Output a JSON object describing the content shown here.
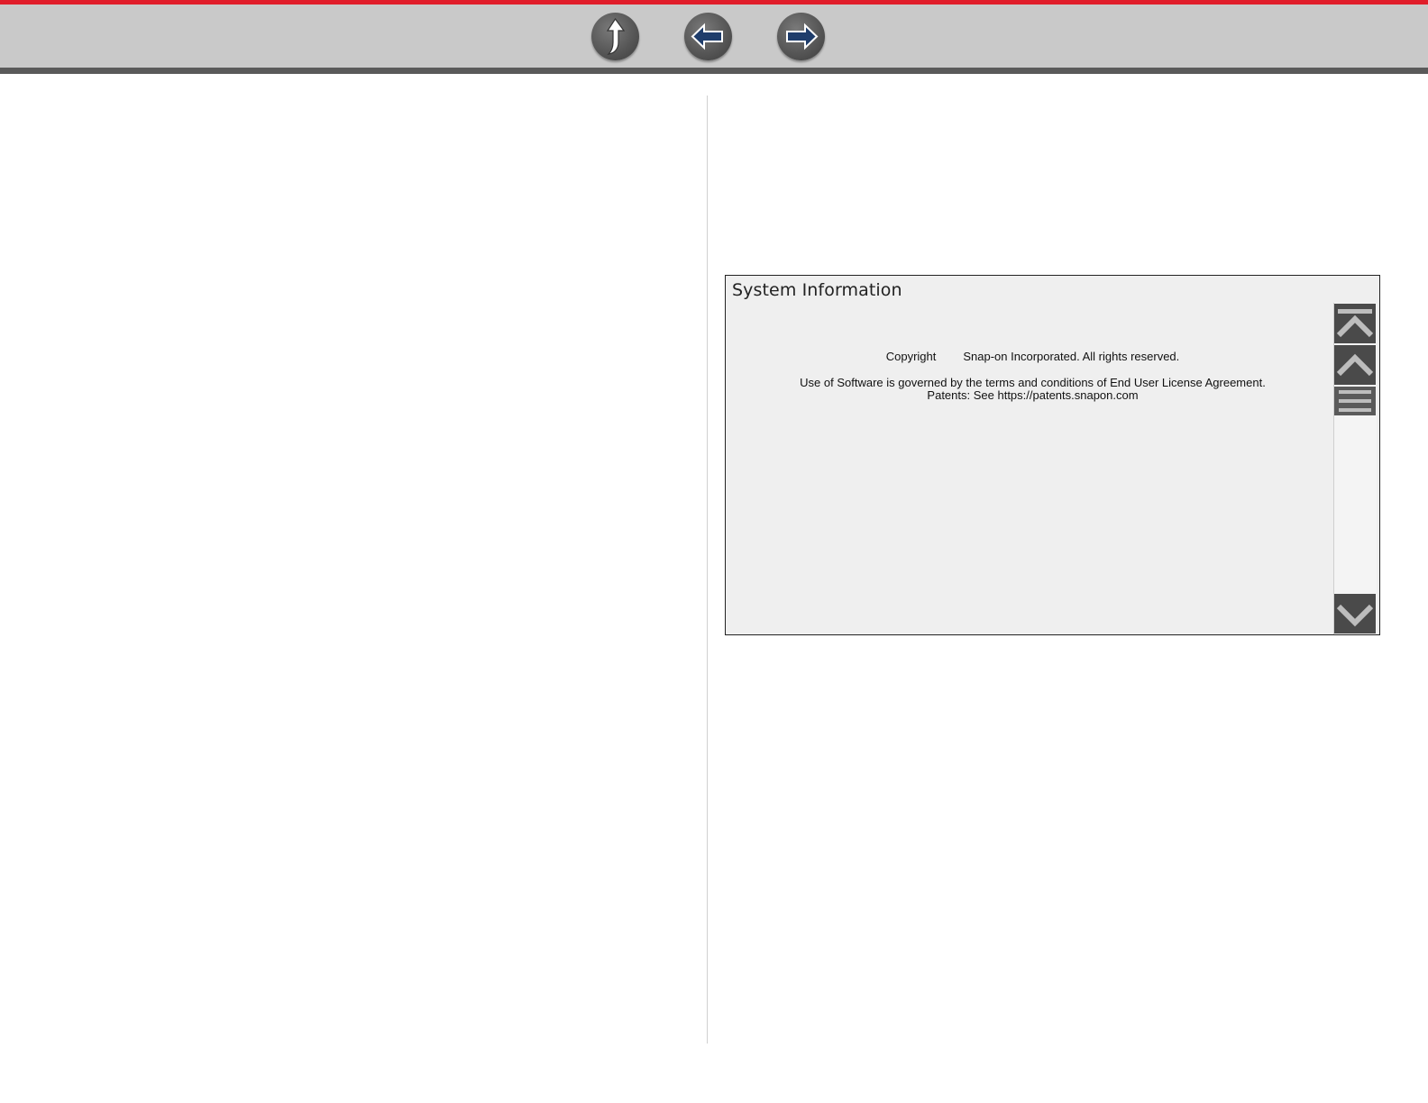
{
  "toolbar": {
    "colors": {
      "background": "#c9c9c9",
      "accent_stripe": "#e11d2a",
      "bottom_stripe": "#5a5a5a",
      "button": "#575757",
      "arrow_fill": "#1f3d6b"
    },
    "buttons": [
      {
        "icon": "up-arrow-icon",
        "label": ""
      },
      {
        "icon": "back-arrow-icon",
        "label": ""
      },
      {
        "icon": "forward-arrow-icon",
        "label": ""
      }
    ]
  },
  "screen": {
    "title": "System Information",
    "copyright_label": "Copyright",
    "copyright_text": "Snap-on Incorporated. All rights reserved.",
    "license_text": "Use of Software is governed by the terms and conditions of End User License Agreement.",
    "patents_text": "Patents: See https://patents.snapon.com",
    "scrollbar": {
      "icons": [
        "scroll-to-top-icon",
        "scroll-up-icon",
        "scroll-thumb-icon",
        "scroll-down-icon"
      ]
    }
  }
}
